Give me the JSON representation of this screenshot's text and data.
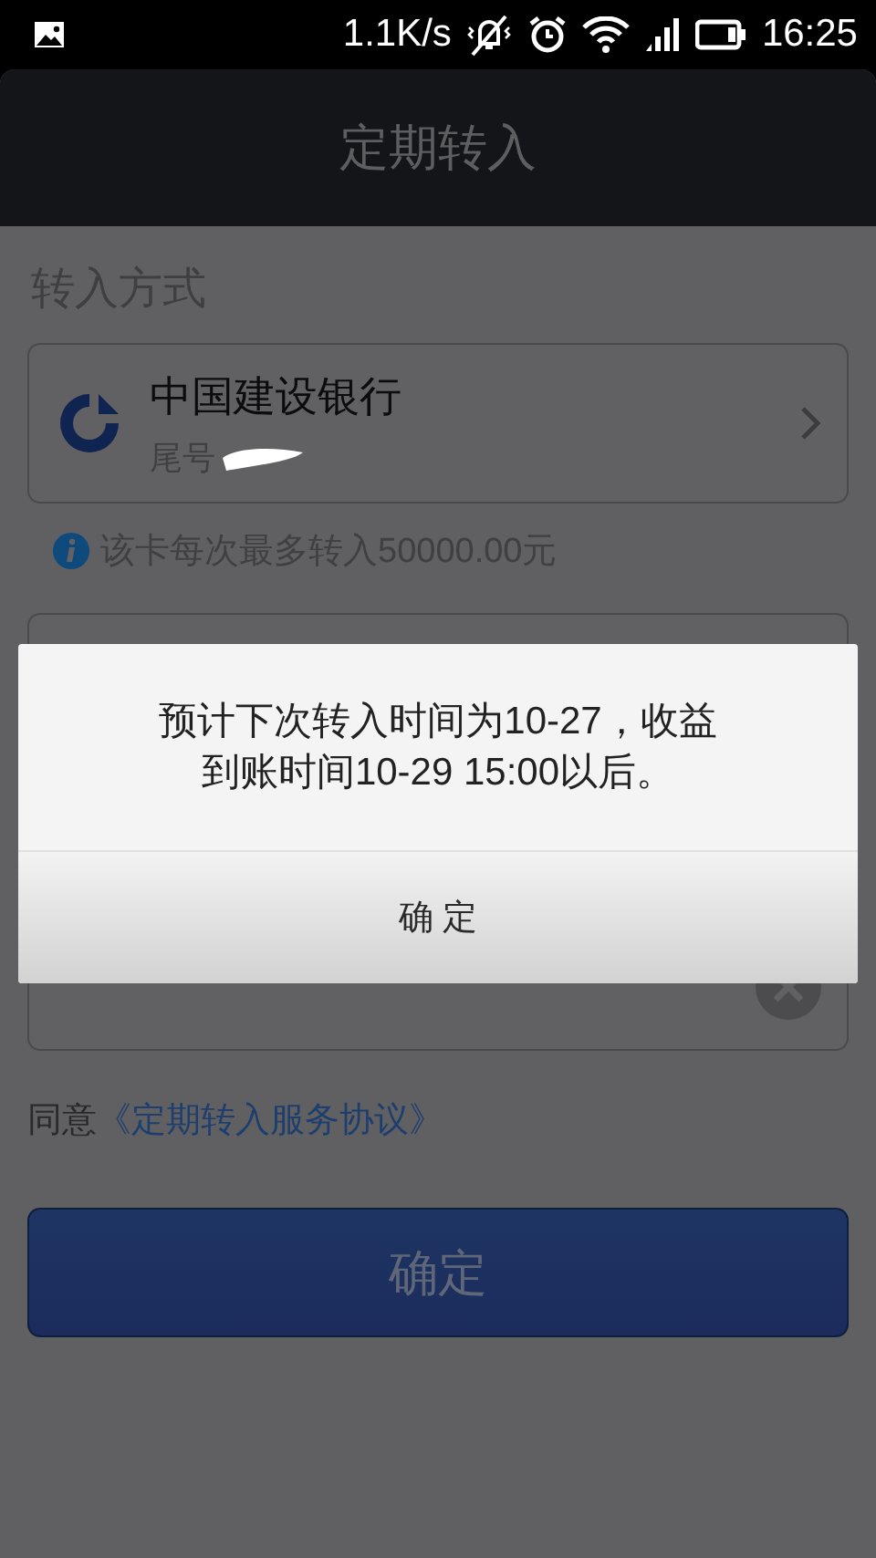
{
  "status_bar": {
    "speed": "1.1K/s",
    "time": "16:25"
  },
  "title": "定期转入",
  "section_label": "转入方式",
  "bank": {
    "name": "中国建设银行",
    "tail_label": "尾号"
  },
  "limit_note": "该卡每次最多转入50000.00元",
  "agreement": {
    "prefix": "同意",
    "link": "《定期转入服务协议》"
  },
  "confirm_button": {
    "label": "确定"
  },
  "dialog": {
    "message": "预计下次转入时间为10-27，收益到账时间10-29 15:00以后。",
    "button": "确 定"
  }
}
